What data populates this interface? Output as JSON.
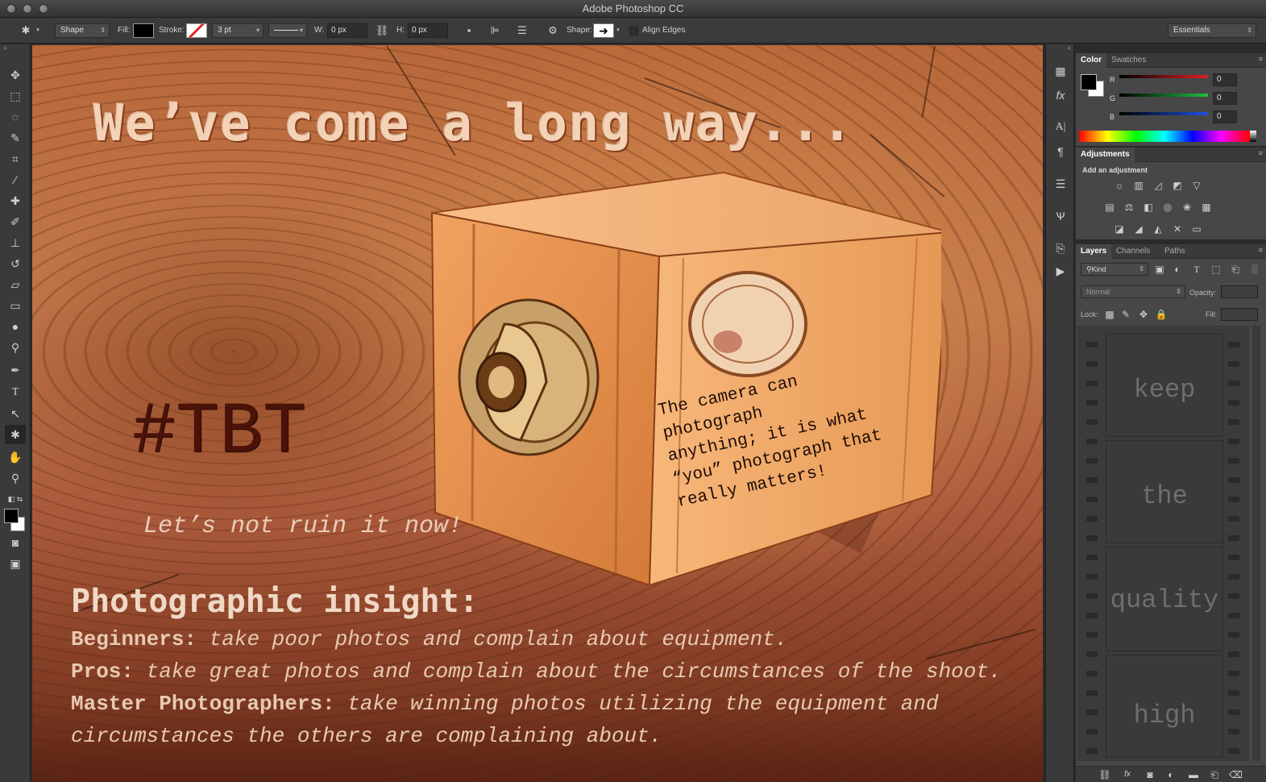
{
  "app": {
    "title": "Adobe Photoshop CC"
  },
  "options_bar": {
    "mode": "Shape",
    "fill_label": "Fill:",
    "stroke_label": "Stroke:",
    "stroke_width": "3 pt",
    "w_label": "W:",
    "w_value": "0 px",
    "h_label": "H:",
    "h_value": "0 px",
    "shape_label": "Shape:",
    "align_edges": "Align Edges",
    "workspace": "Essentials"
  },
  "canvas": {
    "headline": "We’ve come a long way...",
    "hashtag": "#TBT",
    "tagline": "Let’s not ruin it now!",
    "quote": [
      "The camera can photograph",
      "anything; it is what",
      "“you” photograph that",
      "really matters!"
    ],
    "insight_heading": "Photographic insight:",
    "insights": [
      {
        "label": "Beginners:",
        "text": " take poor photos and complain about equipment."
      },
      {
        "label": "Pros:",
        "text": " take great photos and complain about the circumstances of the shoot."
      },
      {
        "label": "Master Photographers:",
        "text": " take winning photos utilizing the equipment and"
      },
      {
        "label": "",
        "text": "circumstances the others are complaining about."
      }
    ]
  },
  "color_panel": {
    "tabs": [
      "Color",
      "Swatches"
    ],
    "channels": [
      {
        "label": "R",
        "value": "0",
        "color": "#e02020"
      },
      {
        "label": "G",
        "value": "0",
        "color": "#20c040"
      },
      {
        "label": "B",
        "value": "0",
        "color": "#2050e0"
      }
    ]
  },
  "adjustments_panel": {
    "tab": "Adjustments",
    "heading": "Add an adjustment"
  },
  "layers_panel": {
    "tabs": [
      "Layers",
      "Channels",
      "Paths"
    ],
    "filter": "Kind",
    "blend_mode": "Normal",
    "opacity_label": "Opacity:",
    "lock_label": "Lock:",
    "fill_label": "Fill:",
    "film_words": [
      "keep",
      "the",
      "quality",
      "high"
    ]
  }
}
